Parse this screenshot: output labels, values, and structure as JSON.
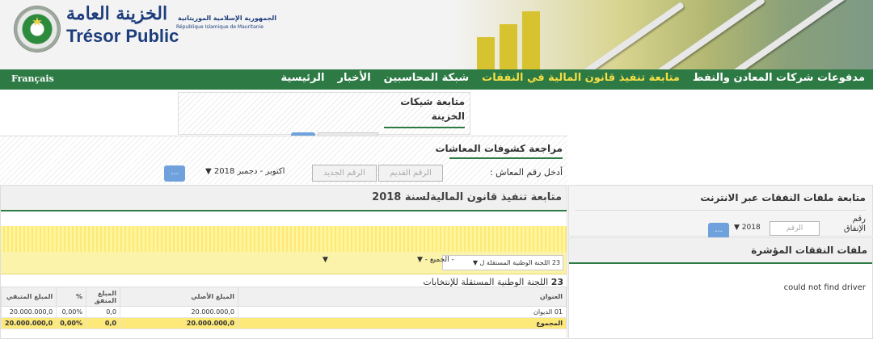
{
  "header": {
    "logo_ar": "الخزينة العامة",
    "logo_fr": "Trésor Public",
    "gov_ar": "الجمهورية الإسلامية الموريتانية",
    "gov_fr": "République Islamique de Mauritanie"
  },
  "nav": {
    "lang": "Français",
    "items": [
      {
        "label": "الرئيسية",
        "active": false
      },
      {
        "label": "الأخبار",
        "active": false
      },
      {
        "label": "شبكة المحاسبين",
        "active": false
      },
      {
        "label": "متابعة تنفيذ قانون المالية في النفقات",
        "active": true
      },
      {
        "label": "مدفوعات شركات المعادن والنفط",
        "active": false
      }
    ]
  },
  "checks": {
    "line1": "متابعة شيكات",
    "line2": "الخزينة"
  },
  "pension": {
    "title": "مراجعة كشوفات المعاشات",
    "label": "أدخل رقم المعاش :",
    "old_placeholder": "الرقم القديم",
    "new_placeholder": "الرقم الجديد",
    "period": "اكتوبر - دجمبر 2018 ▼",
    "button": "..."
  },
  "budget": {
    "title": "متابعة تنفيذ قانون الماليةلسنة 2018",
    "filter_entity": "23 اللجنة الوطنية المستقلة ل ▼",
    "filter_group": "- الجميع - ▼",
    "filter_group_arrow": "▼",
    "entity_num": "23",
    "entity_name": " اللجنة الوطنية المستقلة للإنتخابات",
    "columns": [
      "العنوان",
      "المبلغ الأصلي",
      "المبلغ المنفق",
      "%",
      "المبلغ المتبقي"
    ],
    "rows": [
      [
        "01 الديوان",
        "20.000.000,0",
        "0,0",
        "0,00%",
        "20.000.000,0"
      ]
    ],
    "total": [
      "المجموع",
      "20.000.000,0",
      "0,0",
      "0,00%",
      "20.000.000,0"
    ]
  },
  "online": {
    "title": "متابعة ملفات النفقات عبر الانترنت",
    "label1": "رقم",
    "label2": "الإنفاق",
    "placeholder": "الرقم",
    "year": "2018 ▼",
    "button": "..."
  },
  "indicative": {
    "title": "ملفات النفقات المؤشرة",
    "message": "could not find driver"
  },
  "colors": {
    "nav_green": "#2d7a45",
    "active_yellow": "#f6df45",
    "button_blue": "#6fa2dc",
    "total_yellow": "#fde87a"
  }
}
